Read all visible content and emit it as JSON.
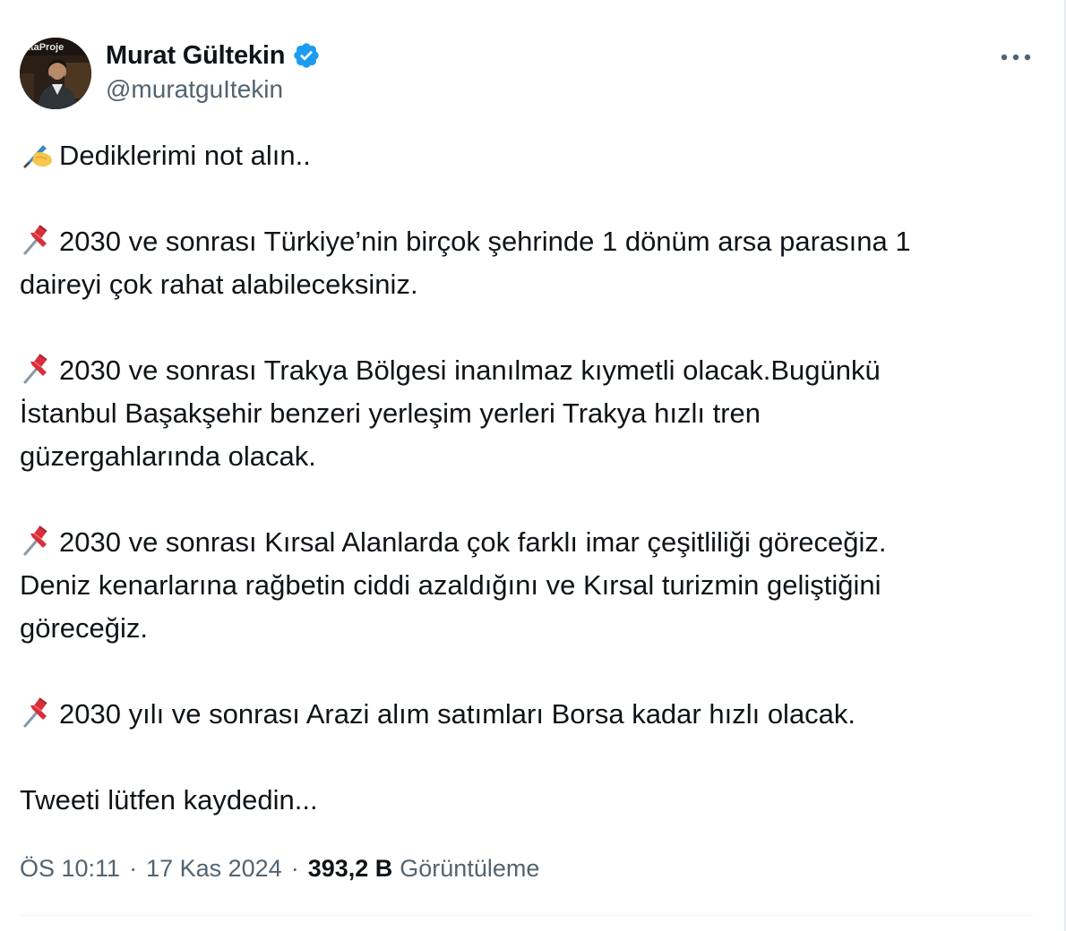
{
  "author": {
    "avatar_text": "AtaProje",
    "display_name": "Murat Gültekin",
    "handle": "@muratguItekin",
    "verified": true
  },
  "icons": {
    "verified": "verified-badge-icon",
    "more": "more-options-icon",
    "writing_hand": "writing-hand-icon",
    "pushpin": "pushpin-icon"
  },
  "colors": {
    "verified_blue": "#1d9bf0",
    "text": "#0f1419",
    "muted": "#536471",
    "pin_red": "#d8303a"
  },
  "tweet": {
    "paragraphs": [
      {
        "emoji": "writing-hand-icon",
        "lines": [
          "Dediklerimi not alın.."
        ]
      },
      {
        "emoji": "pushpin-icon",
        "lines": [
          "2030 ve sonrası Türkiye’nin birçok şehrinde 1 dönüm arsa parasına 1",
          "daireyi çok rahat alabileceksiniz."
        ]
      },
      {
        "emoji": "pushpin-icon",
        "lines": [
          "2030 ve sonrası Trakya Bölgesi inanılmaz kıymetli olacak.Bugünkü",
          "İstanbul Başakşehir benzeri yerleşim yerleri Trakya hızlı tren",
          "güzergahlarında olacak."
        ]
      },
      {
        "emoji": "pushpin-icon",
        "lines": [
          "2030 ve sonrası Kırsal Alanlarda çok farklı imar çeşitliliği göreceğiz.",
          "Deniz kenarlarına rağbetin ciddi azaldığını ve Kırsal turizmin geliştiğini",
          "göreceğiz."
        ]
      },
      {
        "emoji": "pushpin-icon",
        "lines": [
          "2030 yılı ve sonrası Arazi alım satımları Borsa kadar hızlı olacak."
        ]
      },
      {
        "emoji": "",
        "lines": [
          "Tweeti lütfen kaydedin..."
        ]
      }
    ]
  },
  "meta": {
    "time": "ÖS 10:11",
    "separator": "·",
    "date": "17 Kas 2024",
    "views_count": "393,2 B",
    "views_label": "Görüntüleme"
  }
}
